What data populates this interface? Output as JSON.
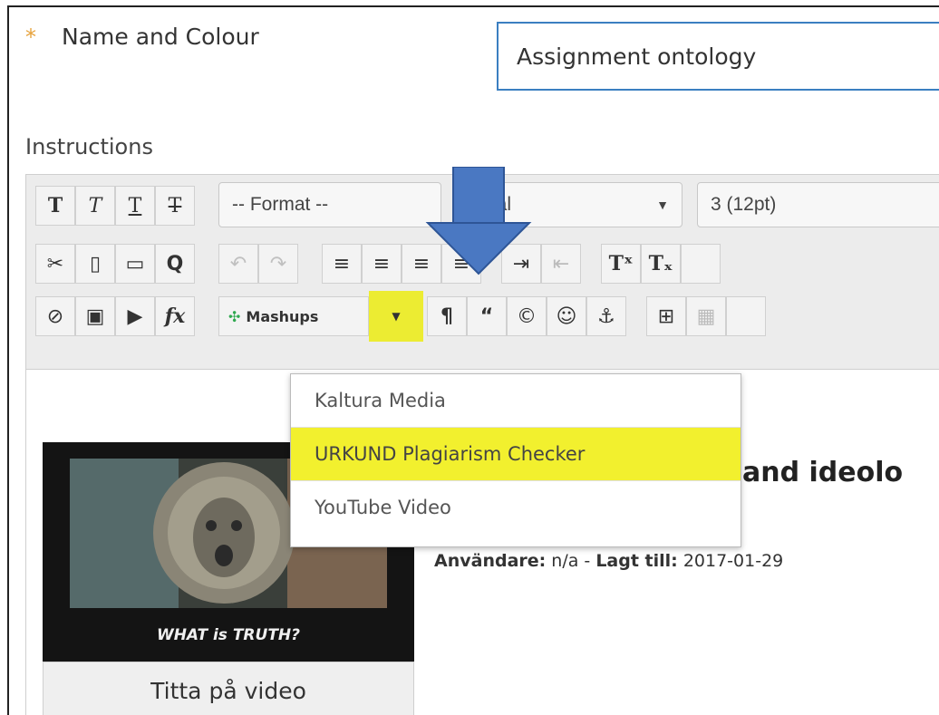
{
  "form": {
    "name_label": "Name and Colour",
    "required_marker": "*",
    "name_value": "Assignment ontology",
    "instructions_label": "Instructions"
  },
  "toolbar": {
    "format_select": "-- Format --",
    "font_select": "Arial",
    "size_select": "3 (12pt)",
    "mashups_label": "Mashups"
  },
  "mashups_menu": {
    "items": [
      "Kaltura Media",
      "URKUND Plagiarism Checker",
      "YouTube Video"
    ],
    "highlighted_index": 1
  },
  "content": {
    "heading_fragment": "and ideolo",
    "user_label": "Användare:",
    "user_value": "n/a -",
    "added_label": "Lagt till:",
    "added_value": "2017-01-29",
    "video_caption": "WHAT is TRUTH?",
    "watch_button": "Titta på video"
  },
  "colors": {
    "accent_border": "#3b7fc1",
    "highlight": "#f2f02e",
    "arrow": "#4a78c2",
    "required": "#e6a23c"
  }
}
